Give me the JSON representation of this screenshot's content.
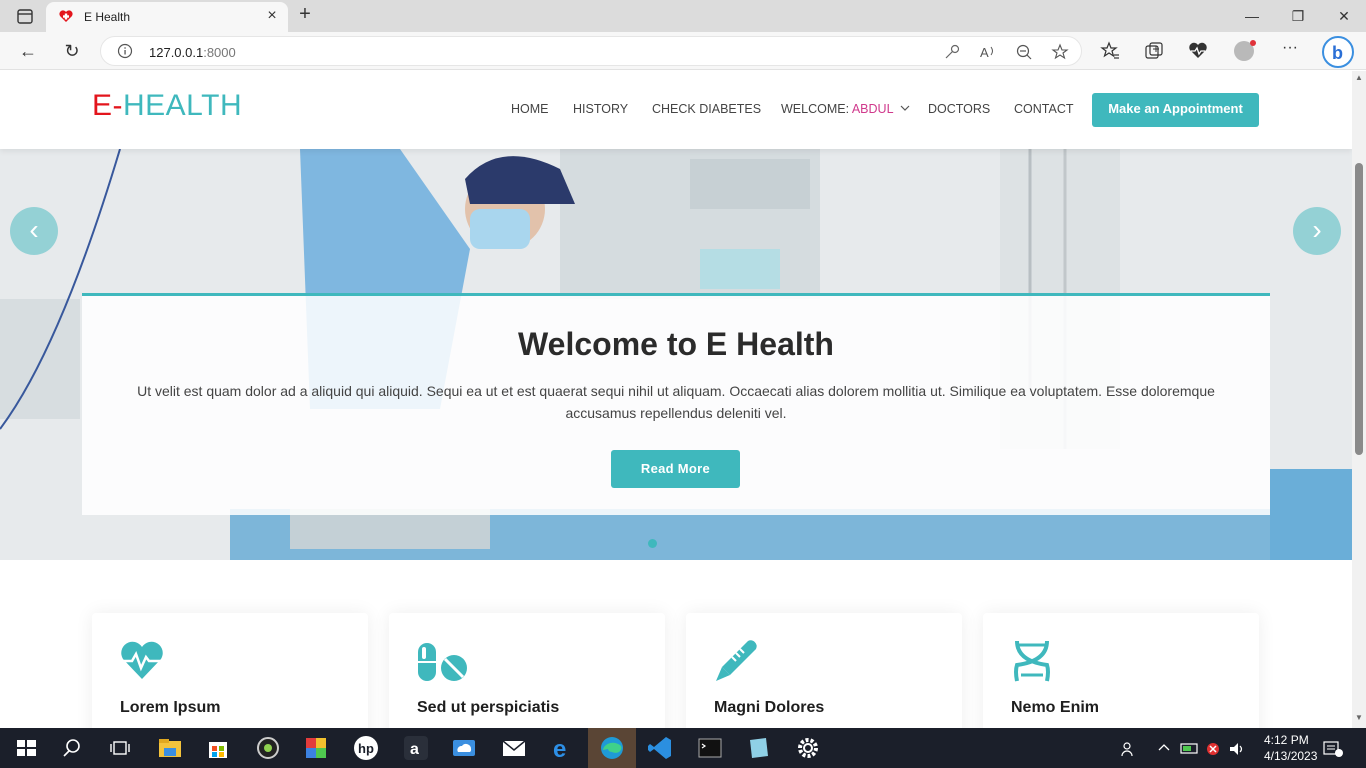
{
  "browser": {
    "tab_title": "E Health",
    "url_host": "127.0.0.1",
    "url_port": ":8000"
  },
  "site": {
    "logo_prefix": "E-",
    "logo_name": "HEALTH",
    "nav": {
      "home": "HOME",
      "history": "HISTORY",
      "check_diabetes": "CHECK DIABETES",
      "welcome_label": "WELCOME: ",
      "welcome_user": "ABDUL",
      "doctors": "DOCTORS",
      "contact": "CONTACT"
    },
    "appointment_button": "Make an Appointment"
  },
  "hero": {
    "title": "Welcome to E Health",
    "text": "Ut velit est quam dolor ad a aliquid qui aliquid. Sequi ea ut et est quaerat sequi nihil ut aliquam. Occaecati alias dolorem mollitia ut. Similique ea voluptatem. Esse doloremque accusamus repellendus deleniti vel.",
    "button": "Read More",
    "prev_glyph": "‹",
    "next_glyph": "›"
  },
  "features": [
    {
      "title": "Lorem Ipsum",
      "icon": "heart-pulse-icon"
    },
    {
      "title": "Sed ut perspiciatis",
      "icon": "pills-icon"
    },
    {
      "title": "Magni Dolores",
      "icon": "thermometer-icon"
    },
    {
      "title": "Nemo Enim",
      "icon": "dna-icon"
    }
  ],
  "taskbar": {
    "time": "4:12 PM",
    "date": "4/13/2023"
  },
  "colors": {
    "accent": "#3fb8bd",
    "logo_red": "#e3151c",
    "highlight": "#d0398c"
  }
}
